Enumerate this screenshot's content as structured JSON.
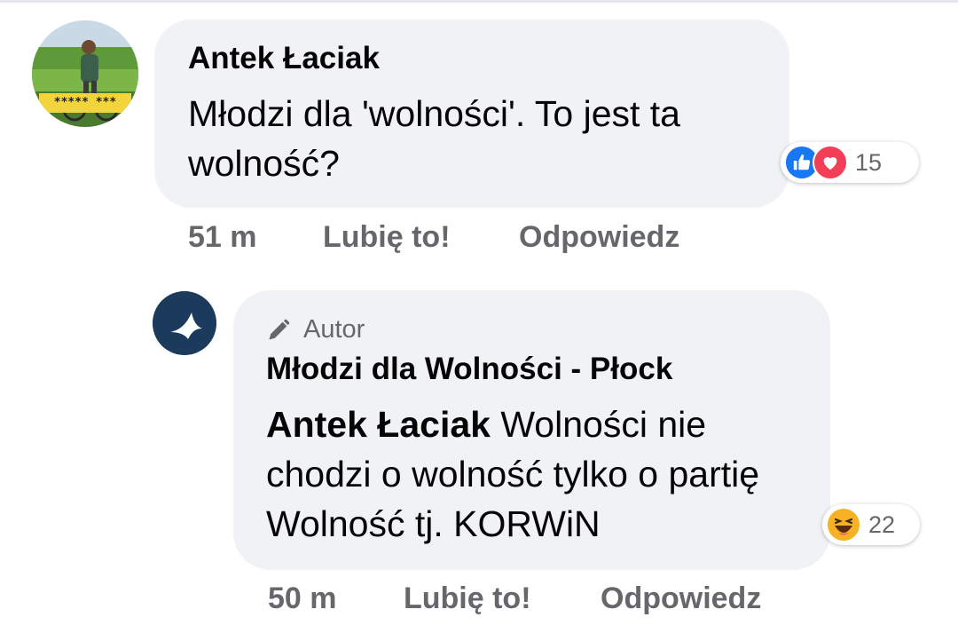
{
  "comment1": {
    "author": "Antek Łaciak",
    "avatar_caption": "***** ***",
    "text": "Młodzi dla 'wolności'. To jest ta wolność?",
    "reactions": {
      "icons": [
        "like-icon",
        "love-icon"
      ],
      "count": "15"
    },
    "time": "51 m",
    "like_label": "Lubię to!",
    "reply_label": "Odpowiedz"
  },
  "comment2": {
    "badge_label": "Autor",
    "author": "Młodzi dla Wolności - Płock",
    "mention": "Antek Łaciak",
    "text": " Wolności nie chodzi o wolność tylko o partię Wolność tj. KORWiN",
    "reactions": {
      "icons": [
        "haha-icon"
      ],
      "count": "22"
    },
    "time": "50 m",
    "like_label": "Lubię to!",
    "reply_label": "Odpowiedz"
  },
  "colors": {
    "bubble": "#f0f2f5",
    "meta_text": "#65676b",
    "like": "#1877f2",
    "love": "#f33e58",
    "haha": "#f7b125"
  }
}
